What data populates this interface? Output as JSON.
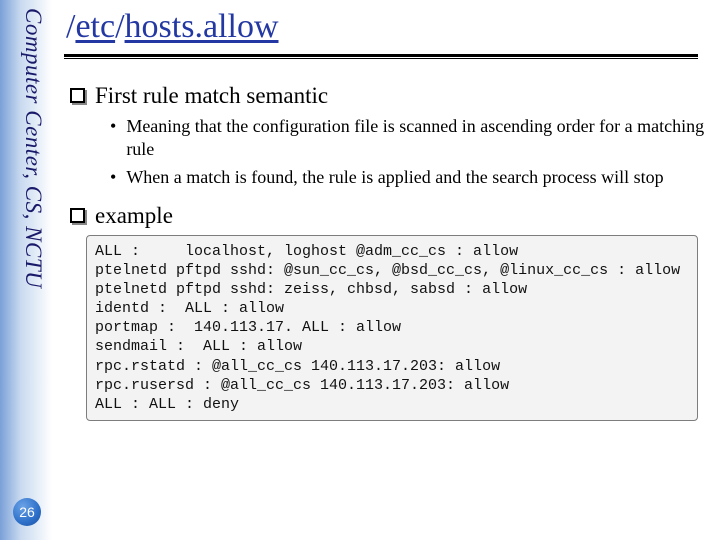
{
  "sidebar": {
    "org": "Computer Center, CS, NCTU"
  },
  "page_number": "26",
  "title_parts": {
    "p1": "/",
    "p2": "etc",
    "p3": "/",
    "p4": "hosts.allow"
  },
  "sections": {
    "s1": {
      "heading": "First rule match semantic",
      "bullets": [
        "Meaning that the configuration file is scanned in ascending order for a matching rule",
        "When a match is found, the rule is applied and the search process will stop"
      ]
    },
    "s2": {
      "heading": "example"
    }
  },
  "code": "ALL :     localhost, loghost @adm_cc_cs : allow\nptelnetd pftpd sshd: @sun_cc_cs, @bsd_cc_cs, @linux_cc_cs : allow\nptelnetd pftpd sshd: zeiss, chbsd, sabsd : allow\nidentd :  ALL : allow\nportmap :  140.113.17. ALL : allow\nsendmail :  ALL : allow\nrpc.rstatd : @all_cc_cs 140.113.17.203: allow\nrpc.rusersd : @all_cc_cs 140.113.17.203: allow\nALL : ALL : deny"
}
